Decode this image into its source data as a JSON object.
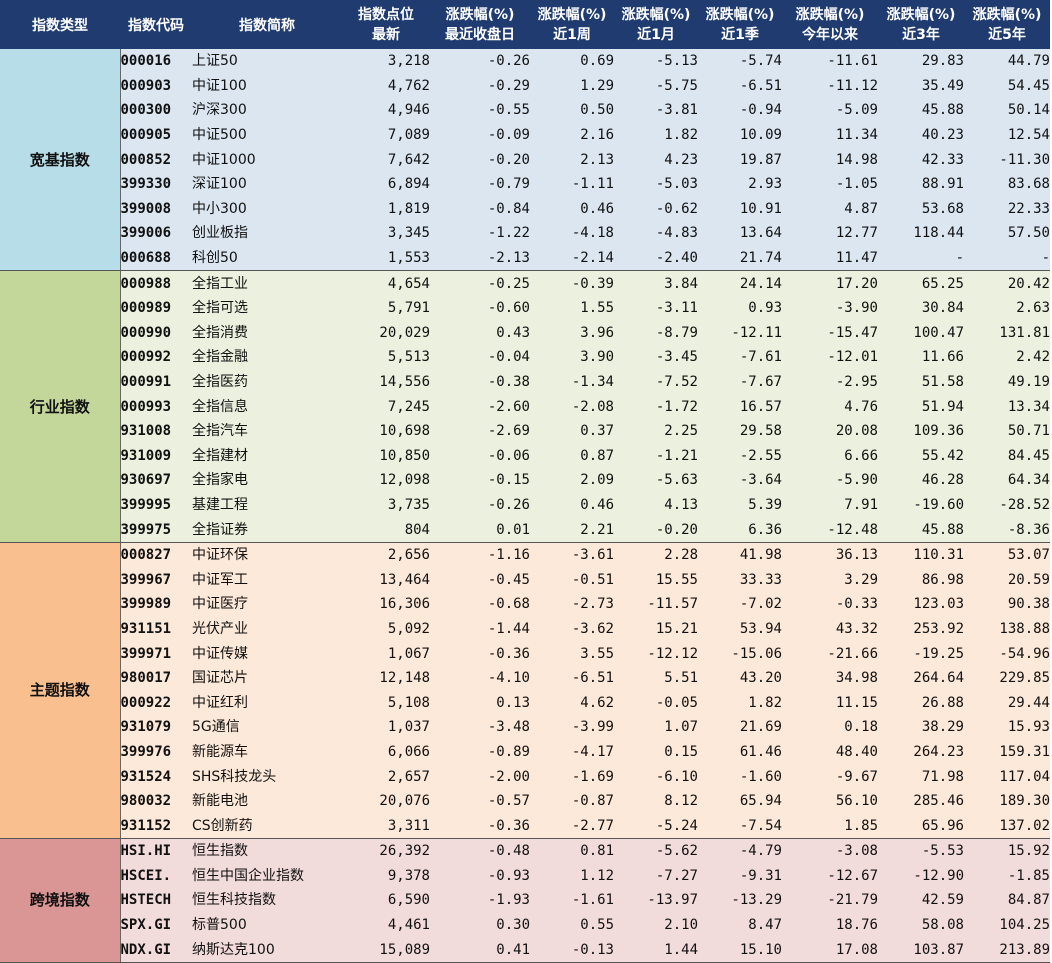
{
  "header": {
    "cols": [
      {
        "l1": "指数类型",
        "l2": ""
      },
      {
        "l1": "指数代码",
        "l2": ""
      },
      {
        "l1": "指数简称",
        "l2": ""
      },
      {
        "l1": "指数点位",
        "l2": "最新"
      },
      {
        "l1": "涨跌幅(%)",
        "l2": "最近收盘日"
      },
      {
        "l1": "涨跌幅(%)",
        "l2": "近1周"
      },
      {
        "l1": "涨跌幅(%)",
        "l2": "近1月"
      },
      {
        "l1": "涨跌幅(%)",
        "l2": "近1季"
      },
      {
        "l1": "涨跌幅(%)",
        "l2": "今年以来"
      },
      {
        "l1": "涨跌幅(%)",
        "l2": "近3年"
      },
      {
        "l1": "涨跌幅(%)",
        "l2": "近5年"
      }
    ]
  },
  "groups": [
    {
      "name": "宽基指数",
      "rows": [
        [
          "000016",
          "上证50",
          "3,218",
          "-0.26",
          "0.69",
          "-5.13",
          "-5.74",
          "-11.61",
          "29.83",
          "44.79"
        ],
        [
          "000903",
          "中证100",
          "4,762",
          "-0.29",
          "1.29",
          "-5.75",
          "-6.51",
          "-11.12",
          "35.49",
          "54.45"
        ],
        [
          "000300",
          "沪深300",
          "4,946",
          "-0.55",
          "0.50",
          "-3.81",
          "-0.94",
          "-5.09",
          "45.88",
          "50.14"
        ],
        [
          "000905",
          "中证500",
          "7,089",
          "-0.09",
          "2.16",
          "1.82",
          "10.09",
          "11.34",
          "40.23",
          "12.54"
        ],
        [
          "000852",
          "中证1000",
          "7,642",
          "-0.20",
          "2.13",
          "4.23",
          "19.87",
          "14.98",
          "42.33",
          "-11.30"
        ],
        [
          "399330",
          "深证100",
          "6,894",
          "-0.79",
          "-1.11",
          "-5.03",
          "2.93",
          "-1.05",
          "88.91",
          "83.68"
        ],
        [
          "399008",
          "中小300",
          "1,819",
          "-0.84",
          "0.46",
          "-0.62",
          "10.91",
          "4.87",
          "53.68",
          "22.33"
        ],
        [
          "399006",
          "创业板指",
          "3,345",
          "-1.22",
          "-4.18",
          "-4.83",
          "13.64",
          "12.77",
          "118.44",
          "57.50"
        ],
        [
          "000688",
          "科创50",
          "1,553",
          "-2.13",
          "-2.14",
          "-2.40",
          "21.74",
          "11.47",
          "-",
          "-"
        ]
      ]
    },
    {
      "name": "行业指数",
      "rows": [
        [
          "000988",
          "全指工业",
          "4,654",
          "-0.25",
          "-0.39",
          "3.84",
          "24.14",
          "17.20",
          "65.25",
          "20.42"
        ],
        [
          "000989",
          "全指可选",
          "5,791",
          "-0.60",
          "1.55",
          "-3.11",
          "0.93",
          "-3.90",
          "30.84",
          "2.63"
        ],
        [
          "000990",
          "全指消费",
          "20,029",
          "0.43",
          "3.96",
          "-8.79",
          "-12.11",
          "-15.47",
          "100.47",
          "131.81"
        ],
        [
          "000992",
          "全指金融",
          "5,513",
          "-0.04",
          "3.90",
          "-3.45",
          "-7.61",
          "-12.01",
          "11.66",
          "2.42"
        ],
        [
          "000991",
          "全指医药",
          "14,556",
          "-0.38",
          "-1.34",
          "-7.52",
          "-7.67",
          "-2.95",
          "51.58",
          "49.19"
        ],
        [
          "000993",
          "全指信息",
          "7,245",
          "-2.60",
          "-2.08",
          "-1.72",
          "16.57",
          "4.76",
          "51.94",
          "13.34"
        ],
        [
          "931008",
          "全指汽车",
          "10,698",
          "-2.69",
          "0.37",
          "2.25",
          "29.58",
          "20.08",
          "109.36",
          "50.71"
        ],
        [
          "931009",
          "全指建材",
          "10,850",
          "-0.06",
          "0.87",
          "-1.21",
          "-2.55",
          "6.66",
          "55.42",
          "84.45"
        ],
        [
          "930697",
          "全指家电",
          "12,098",
          "-0.15",
          "2.09",
          "-5.63",
          "-3.64",
          "-5.90",
          "46.28",
          "64.34"
        ],
        [
          "399995",
          "基建工程",
          "3,735",
          "-0.26",
          "0.46",
          "4.13",
          "5.39",
          "7.91",
          "-19.60",
          "-28.52"
        ],
        [
          "399975",
          "全指证券",
          "804",
          "0.01",
          "2.21",
          "-0.20",
          "6.36",
          "-12.48",
          "45.88",
          "-8.36"
        ]
      ]
    },
    {
      "name": "主题指数",
      "rows": [
        [
          "000827",
          "中证环保",
          "2,656",
          "-1.16",
          "-3.61",
          "2.28",
          "41.98",
          "36.13",
          "110.31",
          "53.07"
        ],
        [
          "399967",
          "中证军工",
          "13,464",
          "-0.45",
          "-0.51",
          "15.55",
          "33.33",
          "3.29",
          "86.98",
          "20.59"
        ],
        [
          "399989",
          "中证医疗",
          "16,306",
          "-0.68",
          "-2.73",
          "-11.57",
          "-7.02",
          "-0.33",
          "123.03",
          "90.38"
        ],
        [
          "931151",
          "光伏产业",
          "5,092",
          "-1.44",
          "-3.62",
          "15.21",
          "53.94",
          "43.32",
          "253.92",
          "138.88"
        ],
        [
          "399971",
          "中证传媒",
          "1,067",
          "-0.36",
          "3.55",
          "-12.12",
          "-15.06",
          "-21.66",
          "-19.25",
          "-54.96"
        ],
        [
          "980017",
          "国证芯片",
          "12,148",
          "-4.10",
          "-6.51",
          "5.51",
          "43.20",
          "34.98",
          "264.64",
          "229.85"
        ],
        [
          "000922",
          "中证红利",
          "5,108",
          "0.13",
          "4.62",
          "-0.05",
          "1.82",
          "11.15",
          "26.88",
          "29.44"
        ],
        [
          "931079",
          "5G通信",
          "1,037",
          "-3.48",
          "-3.99",
          "1.07",
          "21.69",
          "0.18",
          "38.29",
          "15.93"
        ],
        [
          "399976",
          "新能源车",
          "6,066",
          "-0.89",
          "-4.17",
          "0.15",
          "61.46",
          "48.40",
          "264.23",
          "159.31"
        ],
        [
          "931524",
          "SHS科技龙头",
          "2,657",
          "-2.00",
          "-1.69",
          "-6.10",
          "-1.60",
          "-9.67",
          "71.98",
          "117.04"
        ],
        [
          "980032",
          "新能电池",
          "20,076",
          "-0.57",
          "-0.87",
          "8.12",
          "65.94",
          "56.10",
          "285.46",
          "189.30"
        ],
        [
          "931152",
          "CS创新药",
          "3,311",
          "-0.36",
          "-2.77",
          "-5.24",
          "-7.54",
          "1.85",
          "65.96",
          "137.02"
        ]
      ]
    },
    {
      "name": "跨境指数",
      "rows": [
        [
          "HSI.HI",
          "恒生指数",
          "26,392",
          "-0.48",
          "0.81",
          "-5.62",
          "-4.79",
          "-3.08",
          "-5.53",
          "15.92"
        ],
        [
          "HSCEI.",
          "恒生中国企业指数",
          "9,378",
          "-0.93",
          "1.12",
          "-7.27",
          "-9.31",
          "-12.67",
          "-12.90",
          "-1.85"
        ],
        [
          "HSTECH",
          "恒生科技指数",
          "6,590",
          "-1.93",
          "-1.61",
          "-13.97",
          "-13.29",
          "-21.79",
          "42.59",
          "84.87"
        ],
        [
          "SPX.GI",
          "标普500",
          "4,461",
          "0.30",
          "0.55",
          "2.10",
          "8.47",
          "18.76",
          "58.08",
          "104.25"
        ],
        [
          "NDX.GI",
          "纳斯达克100",
          "15,089",
          "0.41",
          "-0.13",
          "1.44",
          "15.10",
          "17.08",
          "103.87",
          "213.89"
        ]
      ]
    }
  ]
}
